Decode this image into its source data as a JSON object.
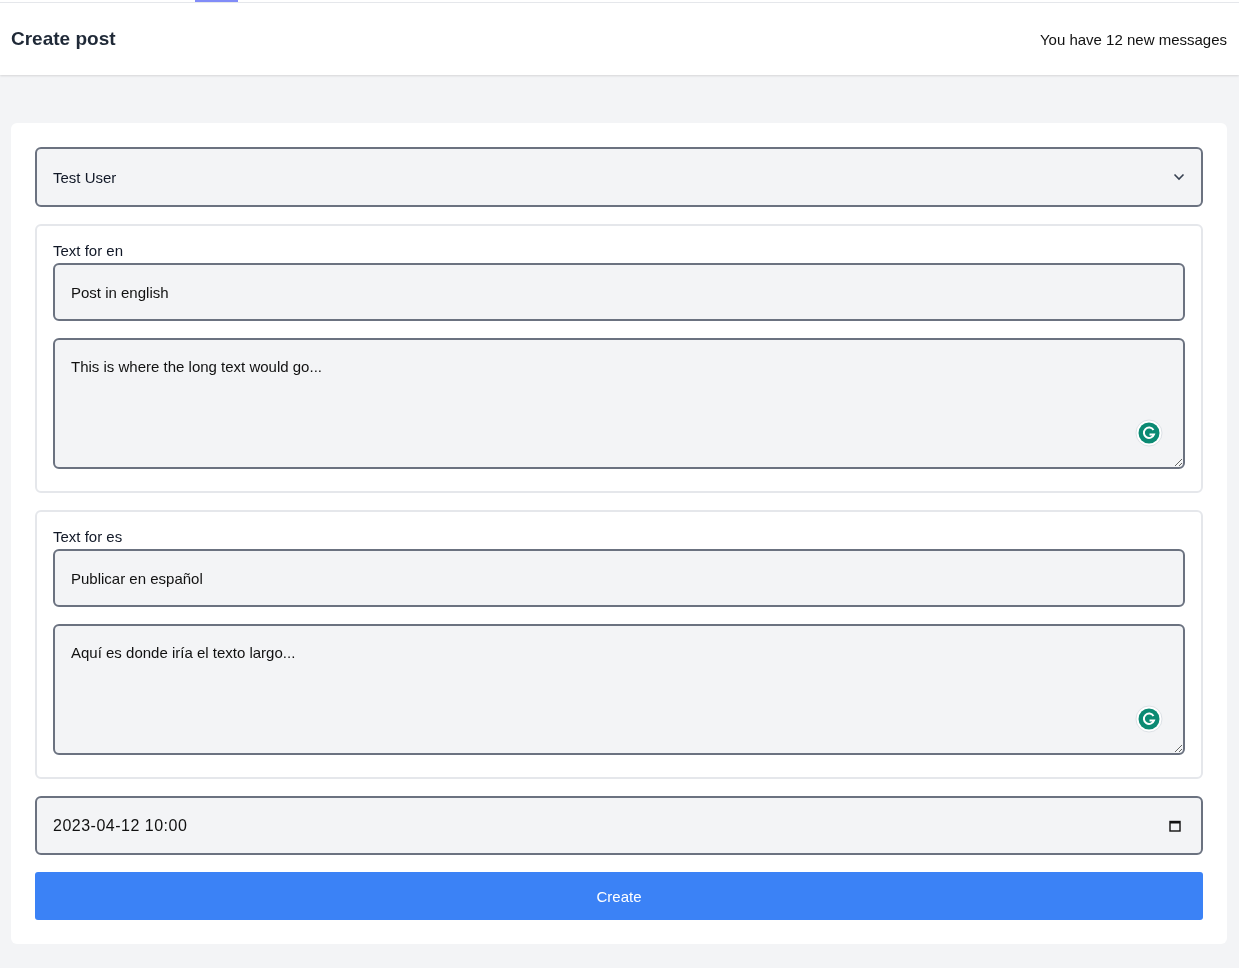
{
  "header": {
    "title": "Create post",
    "messages": "You have 12 new messages"
  },
  "form": {
    "author": "Test User",
    "sections": [
      {
        "label": "Text for en",
        "title": "Post in english",
        "body": "This is where the long text would go..."
      },
      {
        "label": "Text for es",
        "title": "Publicar en español",
        "body": "Aquí es donde iría el texto largo..."
      }
    ],
    "datetime": "2023-04-12 10:00",
    "submit": "Create"
  }
}
